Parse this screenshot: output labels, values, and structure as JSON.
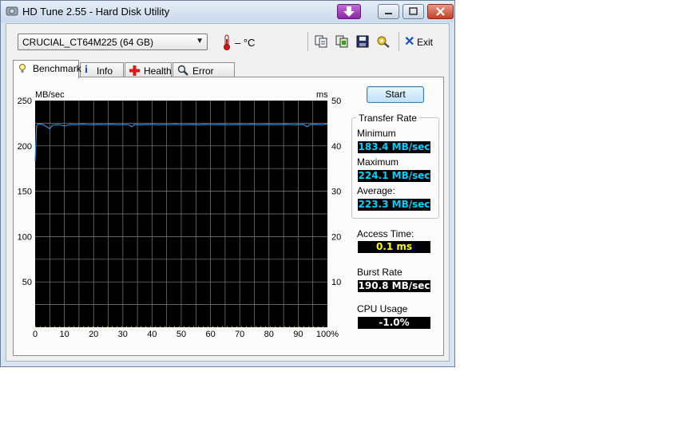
{
  "window": {
    "title": "HD Tune 2.55 - Hard Disk Utility"
  },
  "toolbar": {
    "drive": "CRUCIAL_CT64M225 (64 GB)",
    "temperature": "– °C",
    "exit_label": "Exit",
    "icons": [
      "copy-icon",
      "copy-all-icon",
      "save-icon",
      "options-icon",
      "exit-icon"
    ]
  },
  "tabs": [
    {
      "label": "Benchmark",
      "icon": "benchmark-icon",
      "active": true
    },
    {
      "label": "Info",
      "icon": "info-icon",
      "active": false
    },
    {
      "label": "Health",
      "icon": "health-icon",
      "active": false
    },
    {
      "label": "Error Scan",
      "icon": "error-scan-icon",
      "active": false
    }
  ],
  "benchmark": {
    "start_label": "Start",
    "transfer_rate_title": "Transfer Rate",
    "minimum_label": "Minimum",
    "minimum_value": "183.4 MB/sec",
    "maximum_label": "Maximum",
    "maximum_value": "224.1 MB/sec",
    "average_label": "Average:",
    "average_value": "223.3 MB/sec",
    "access_time_label": "Access Time:",
    "access_time_value": "0.1 ms",
    "burst_rate_label": "Burst Rate",
    "burst_rate_value": "190.8 MB/sec",
    "cpu_usage_label": "CPU Usage",
    "cpu_usage_value": "-1.0%"
  },
  "chart_data": {
    "type": "line",
    "ylabel_left": "MB/sec",
    "ylabel_right": "ms",
    "y_left_ticks": [
      "250",
      "200",
      "150",
      "100",
      "50"
    ],
    "y_right_ticks": [
      "50",
      "40",
      "30",
      "20",
      "10"
    ],
    "x_ticks": [
      "0",
      "10",
      "20",
      "30",
      "40",
      "50",
      "60",
      "70",
      "80",
      "90",
      "100%"
    ],
    "ylim_left": [
      0,
      250
    ],
    "ylim_right": [
      0,
      50
    ],
    "xlim": [
      0,
      100
    ],
    "grid": true,
    "colors": {
      "background": "#000000",
      "grid": "#808080",
      "transfer": "#2f8fd8",
      "access": "#e8e800"
    },
    "series": [
      {
        "x": [
          0,
          0.5,
          1,
          2,
          3,
          4,
          5,
          6,
          8,
          10,
          12,
          14,
          16,
          18,
          20,
          22,
          24,
          26,
          28,
          30,
          32,
          33,
          34,
          36,
          38,
          40,
          42,
          44,
          46,
          48,
          50,
          52,
          54,
          56,
          58,
          60,
          62,
          64,
          66,
          68,
          70,
          72,
          74,
          76,
          78,
          80,
          82,
          84,
          86,
          88,
          90,
          92,
          93,
          94,
          96,
          98,
          100
        ],
        "values": [
          183.4,
          222,
          224,
          224,
          223,
          221,
          219,
          223,
          223.5,
          222,
          223.5,
          223.3,
          223.8,
          223.4,
          223.2,
          223.6,
          223.4,
          223.7,
          223.3,
          223.5,
          223.4,
          221,
          223.6,
          223.2,
          223.5,
          223.7,
          223.3,
          223.5,
          223.4,
          223.8,
          223.3,
          223.5,
          223.6,
          223.2,
          223.7,
          223.4,
          223.5,
          223.6,
          223.3,
          223.5,
          223.6,
          223.4,
          223.7,
          223.3,
          223.5,
          223.6,
          223.4,
          223.5,
          223.7,
          223.3,
          223.5,
          223.6,
          221,
          223.5,
          223.7,
          223.4,
          224.1
        ]
      }
    ]
  }
}
